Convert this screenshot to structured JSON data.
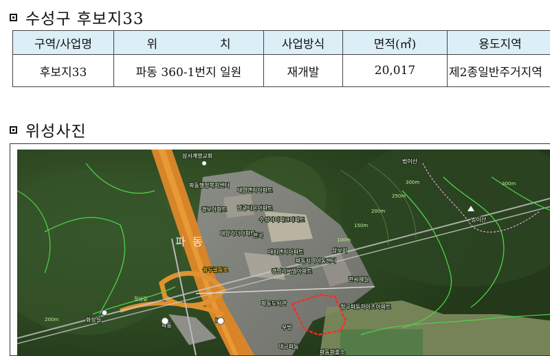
{
  "sections": {
    "info_title": "수성구 후보지33",
    "photo_title": "위성사진"
  },
  "table": {
    "headers": [
      "구역/사업명",
      "위  치",
      "사업방식",
      "면적(㎡)",
      "용도지역"
    ],
    "row": [
      "후보지33",
      "파동 360-1번지 일원",
      "재개발",
      "20,017",
      "제2종일반주거지역"
    ]
  },
  "map": {
    "labels": {
      "church": "삼서계명교회",
      "pa_dong_center": "파동행정복지센터",
      "apt_taeyeong": "태영엔지아파트",
      "apt_gyeongbo": "경보아파트",
      "apt_namgwang": "남광타운아파트",
      "apt_susung": "수성아이파크아파트",
      "apt_taeyang": "태양리더아파트",
      "apt_hanguk": "한국",
      "apt_daeji": "대지엔지아파트",
      "apt_gyeongnam": "경남리버빌아파트",
      "pa_dong_office": "파동지역아동센터",
      "samboji": "삼보지",
      "hansijesil": "한씨재실",
      "library": "파동도서관",
      "apt_cheonggu": "청구파동하이츠아파트",
      "apt_woobang": "우방",
      "apt_daegu": "대구파동",
      "hwajangsil": "화장실",
      "beobisan_top": "법이산",
      "beobisan_bottom": "법이산",
      "pa_big": "파",
      "dong_big": "동",
      "pa_dong_ic": "파동",
      "ic_label": "IC",
      "contour_300": "300m",
      "contour_250": "250m",
      "contour_200": "200m",
      "contour_150": "150m",
      "contour_100": "100m",
      "contour_200b": "200m",
      "contour_300b": "300m",
      "road_name": "용두골동로",
      "jeongsangil": "정상길",
      "pa_dong_bottom": "파동파출소"
    }
  }
}
